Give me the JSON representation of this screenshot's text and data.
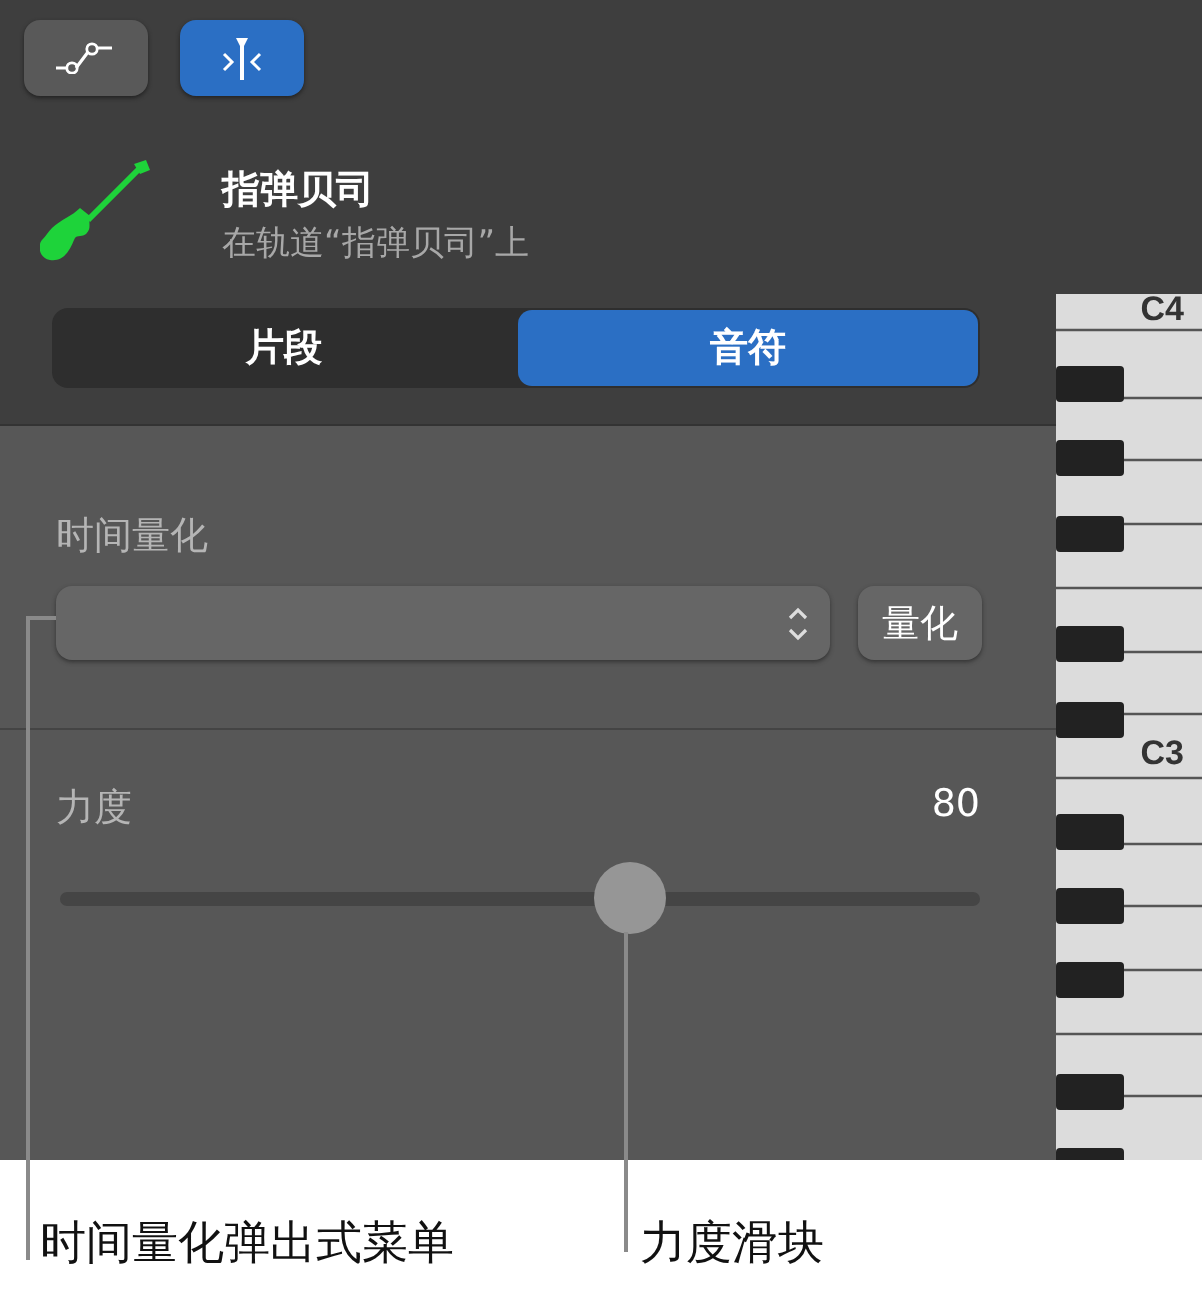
{
  "toolbar": [
    {
      "kind": "automation",
      "selected": false
    },
    {
      "kind": "quantize",
      "selected": true
    }
  ],
  "track": {
    "name": "指弹贝司",
    "subtitle": "在轨道“指弹贝司”上"
  },
  "tabs": [
    {
      "label": "片段",
      "selected": false
    },
    {
      "label": "音符",
      "selected": true
    }
  ],
  "time_quantize": {
    "label": "时间量化",
    "button": "量化"
  },
  "velocity": {
    "label": "力度",
    "reading": "80",
    "level": 0.62
  },
  "piano": {
    "labels": [
      "C4",
      "C3"
    ]
  },
  "callouts": [
    "时间量化弹出式菜单",
    "力度滑块"
  ]
}
